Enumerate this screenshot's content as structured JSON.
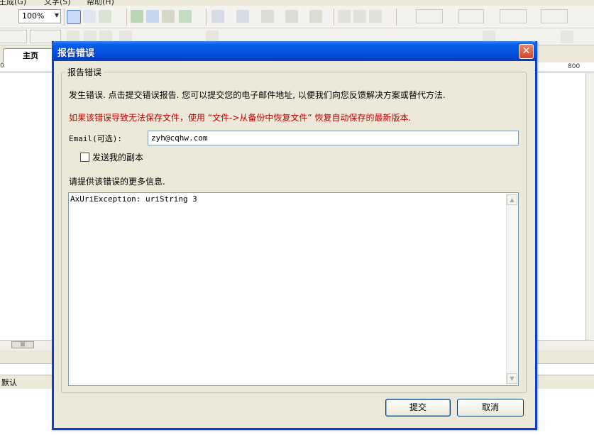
{
  "app": {
    "menubar": {
      "items": [
        "生成(G)",
        "文字(S)",
        "帮助(H)"
      ]
    },
    "toolbar": {
      "zoom": "100%"
    },
    "tabs": [
      {
        "label": "主页"
      }
    ],
    "ruler": {
      "left_mark": "0",
      "right_mark": "800"
    },
    "status": {
      "label": "默认"
    }
  },
  "dialog": {
    "title": "报告错误",
    "close_label": "✕",
    "group_title": "报告错误",
    "message": "发生错误. 点击提交错误报告. 您可以提交您的电子邮件地址, 以便我们向您反馈解决方案或替代方法.",
    "warning": "如果该错误导致无法保存文件，使用 “文件->从备份中恢复文件” 恢复自动保存的最新版本.",
    "email_label": "Email(可选):",
    "email_value": "zyh@cqhw.com",
    "send_copy_label": "发送我的副本",
    "send_copy_checked": false,
    "more_info_label": "请提供该错误的更多信息.",
    "details_text": "AxUriException: uriString 3",
    "submit_label": "提交",
    "cancel_label": "取消"
  },
  "colors": {
    "titlebar": "#0553e3",
    "warning_text": "#c00000",
    "dialog_bg": "#ece9d8"
  }
}
